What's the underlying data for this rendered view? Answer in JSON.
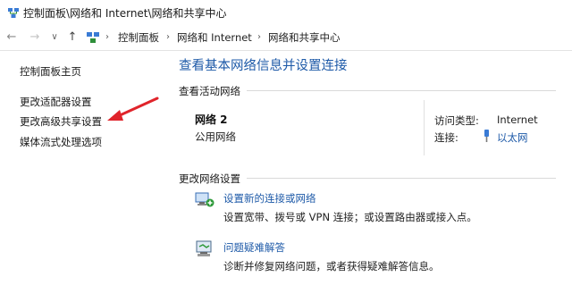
{
  "window": {
    "title": "控制面板\\网络和 Internet\\网络和共享中心",
    "app_icon": "network-center-icon"
  },
  "nav": {
    "back_icon": "←",
    "forward_icon": "→",
    "dropdown_icon": "∨",
    "up_icon": "↑",
    "sep": "›",
    "breadcrumbs": [
      "控制面板",
      "网络和 Internet",
      "网络和共享中心"
    ]
  },
  "sidebar": {
    "items": [
      {
        "label": "控制面板主页"
      },
      {
        "label": "更改适配器设置"
      },
      {
        "label": "更改高级共享设置"
      },
      {
        "label": "媒体流式处理选项"
      }
    ]
  },
  "main": {
    "title": "查看基本网络信息并设置连接",
    "active_section": "查看活动网络",
    "network": {
      "name": "网络 2",
      "type": "公用网络",
      "access_type_label": "访问类型:",
      "access_type_value": "Internet",
      "connection_label": "连接:",
      "connection_value": "以太网"
    },
    "change_section": "更改网络设置",
    "tasks": [
      {
        "title": "设置新的连接或网络",
        "desc": "设置宽带、拨号或 VPN 连接；或设置路由器或接入点。",
        "icon": "new-connection-icon"
      },
      {
        "title": "问题疑难解答",
        "desc": "诊断并修复网络问题，或者获得疑难解答信息。",
        "icon": "troubleshoot-icon"
      }
    ]
  },
  "colors": {
    "link": "#1e5aa8",
    "annotation_arrow": "#e0242b"
  }
}
